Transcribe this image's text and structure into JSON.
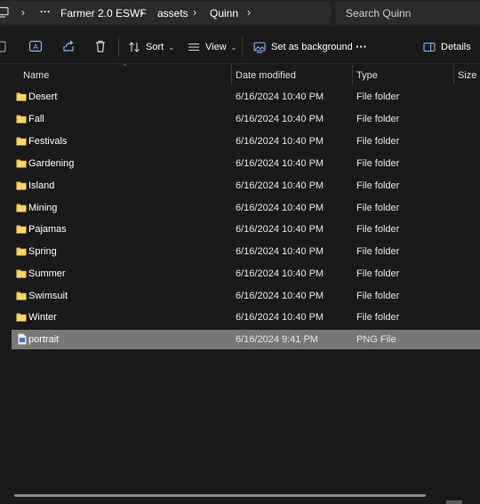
{
  "address_bar": {
    "breadcrumbs": [
      "Farmer 2.0 ESWF",
      "assets",
      "Quinn"
    ],
    "overflow_label": "···",
    "separator": "›"
  },
  "search": {
    "placeholder": "Search Quinn"
  },
  "toolbar": {
    "sort_label": "Sort",
    "view_label": "View",
    "set_background_label": "Set as background",
    "more_label": "···",
    "details_label": "Details"
  },
  "columns": {
    "name": "Name",
    "date": "Date modified",
    "type": "Type",
    "size": "Size"
  },
  "files": [
    {
      "name": "Desert",
      "date": "6/16/2024 10:40 PM",
      "type": "File folder",
      "kind": "folder"
    },
    {
      "name": "Fall",
      "date": "6/16/2024 10:40 PM",
      "type": "File folder",
      "kind": "folder"
    },
    {
      "name": "Festivals",
      "date": "6/16/2024 10:40 PM",
      "type": "File folder",
      "kind": "folder"
    },
    {
      "name": "Gardening",
      "date": "6/16/2024 10:40 PM",
      "type": "File folder",
      "kind": "folder"
    },
    {
      "name": "Island",
      "date": "6/16/2024 10:40 PM",
      "type": "File folder",
      "kind": "folder"
    },
    {
      "name": "Mining",
      "date": "6/16/2024 10:40 PM",
      "type": "File folder",
      "kind": "folder"
    },
    {
      "name": "Pajamas",
      "date": "6/16/2024 10:40 PM",
      "type": "File folder",
      "kind": "folder"
    },
    {
      "name": "Spring",
      "date": "6/16/2024 10:40 PM",
      "type": "File folder",
      "kind": "folder"
    },
    {
      "name": "Summer",
      "date": "6/16/2024 10:40 PM",
      "type": "File folder",
      "kind": "folder"
    },
    {
      "name": "Swimsuit",
      "date": "6/16/2024 10:40 PM",
      "type": "File folder",
      "kind": "folder"
    },
    {
      "name": "Winter",
      "date": "6/16/2024 10:40 PM",
      "type": "File folder",
      "kind": "folder"
    },
    {
      "name": "portrait",
      "date": "6/16/2024 9:41 PM",
      "type": "PNG File",
      "kind": "image",
      "selected": true
    }
  ],
  "colors": {
    "background": "#191919",
    "folder": "#f3c246",
    "selection": "#777777",
    "accent": "#4cc2ff"
  }
}
